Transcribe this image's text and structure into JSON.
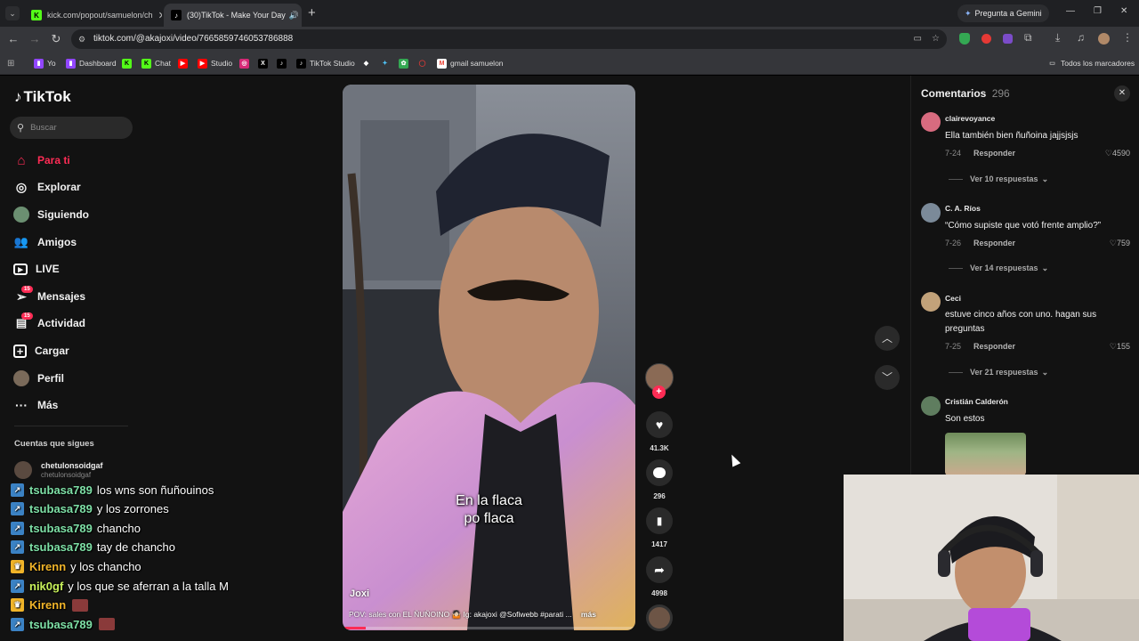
{
  "browser": {
    "tabs": [
      {
        "title": "kick.com/popout/samuelon/ch",
        "active": false
      },
      {
        "title": "(30)TikTok - Make Your Day",
        "active": true
      }
    ],
    "gemini_label": "Pregunta a Gemini",
    "url": "tiktok.com/@akajoxi/video/7665859746053786888",
    "bookmarks": [
      "Yo",
      "Dashboard",
      "Chat",
      "Studio",
      "TikTok Studio",
      "gmail samuelon"
    ],
    "all_bookmarks": "Todos los marcadores"
  },
  "tiktok": {
    "logo": "TikTok",
    "search_placeholder": "Buscar",
    "nav": [
      "Para ti",
      "Explorar",
      "Siguiendo",
      "Amigos",
      "LIVE",
      "Mensajes",
      "Actividad",
      "Cargar",
      "Perfil",
      "Más"
    ],
    "messages_badge": "15",
    "activity_badge": "15",
    "following_title": "Cuentas que sigues",
    "following": [
      {
        "name": "chetulonsoidgaf",
        "handle": "chetulonsoidgaf"
      }
    ],
    "video": {
      "caption_overlay": [
        "En la flaca",
        "po flaca"
      ],
      "author": "Joxi",
      "description": "POV: sales con EL ÑUÑOINO 🤷🏻 Ig: akajoxi @Sofiwebb #parati ...",
      "more": "más",
      "progress": 0.08
    },
    "actions": {
      "likes": "41.3K",
      "comments": "296",
      "saves": "1417",
      "shares": "4998"
    },
    "comments_panel": {
      "title": "Comentarios",
      "count": "296",
      "reply_label": "Responder",
      "items": [
        {
          "user": "clairevoyance",
          "text": "Ella también bien ñuñoina jajjsjsjs",
          "date": "7-24",
          "likes": "4590",
          "replies": "Ver 10 respuestas"
        },
        {
          "user": "C. A. Ríos",
          "text": "“Cómo supiste que votó frente amplio?”",
          "date": "7-26",
          "likes": "759",
          "replies": "Ver 14 respuestas"
        },
        {
          "user": "Ceci",
          "text": "estuve cinco años con uno. hagan sus preguntas",
          "date": "7-25",
          "likes": "155",
          "replies": "Ver 21 respuestas"
        },
        {
          "user": "Cristián Calderón",
          "text": "Son estos"
        }
      ]
    }
  },
  "stream_chat": [
    {
      "user": "tsubasa789",
      "msg": "los wns son ñuñouinos",
      "color": "#7ee0a6"
    },
    {
      "user": "tsubasa789",
      "msg": "y los zorrones",
      "color": "#7ee0a6"
    },
    {
      "user": "tsubasa789",
      "msg": "chancho",
      "color": "#7ee0a6"
    },
    {
      "user": "tsubasa789",
      "msg": "tay de chancho",
      "color": "#7ee0a6"
    },
    {
      "user": "Kirenn",
      "msg": "y los chancho",
      "color": "#f0b429"
    },
    {
      "user": "nik0gf",
      "msg": "y los que se aferran a la talla M",
      "color": "#c7f05a"
    },
    {
      "user": "Kirenn",
      "msg": "",
      "color": "#f0b429"
    },
    {
      "user": "tsubasa789",
      "msg": "",
      "color": "#7ee0a6"
    }
  ],
  "colors": {
    "tiktok_red": "#fe2c55",
    "bg": "#121212",
    "chrome": "#35363a"
  }
}
